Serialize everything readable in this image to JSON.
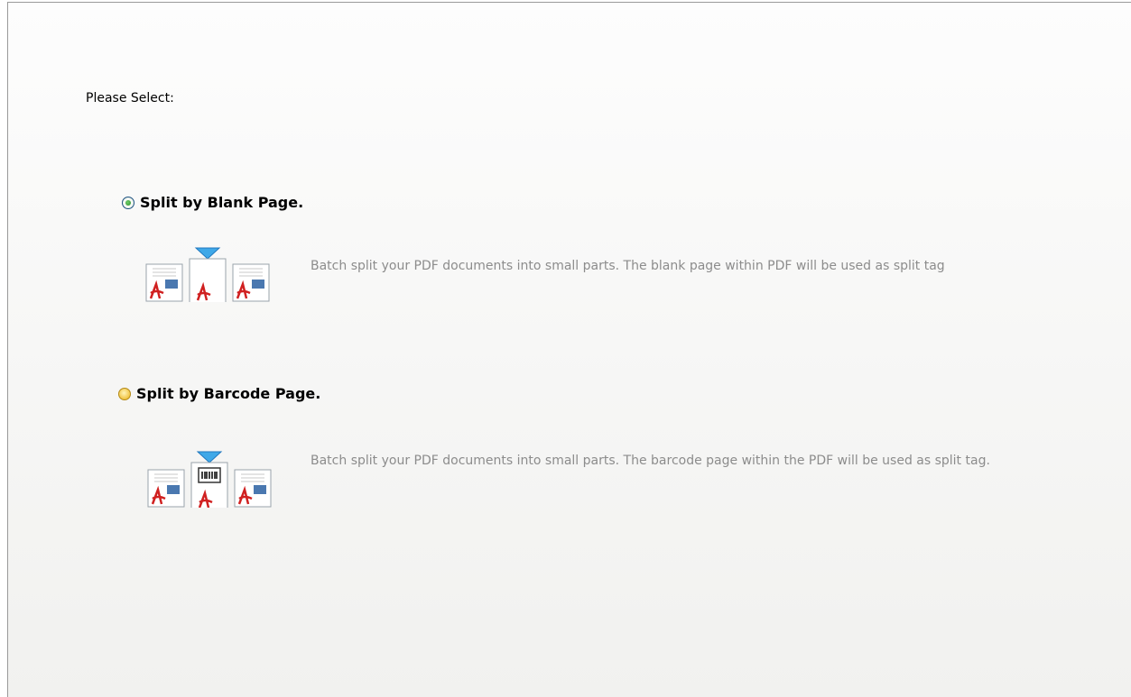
{
  "prompt": "Please Select:",
  "options": [
    {
      "label": "Split by Blank Page.",
      "selected": true,
      "description": "Batch split your PDF documents into small parts. The blank page within PDF will be used as split tag"
    },
    {
      "label": "Split by Barcode Page.",
      "selected": false,
      "description": "Batch split your PDF documents into small parts. The barcode page within the PDF will be used as split tag."
    }
  ],
  "colors": {
    "selected_radio": "#2c8a2a",
    "unselected_radio": "#f1c443",
    "description_text": "#8c8c8c",
    "marker_arrow": "#3fa8e8"
  },
  "icons": [
    "pdf-document-icon",
    "blank-page-marker-icon",
    "barcode-page-marker-icon",
    "split-arrow-icon"
  ]
}
